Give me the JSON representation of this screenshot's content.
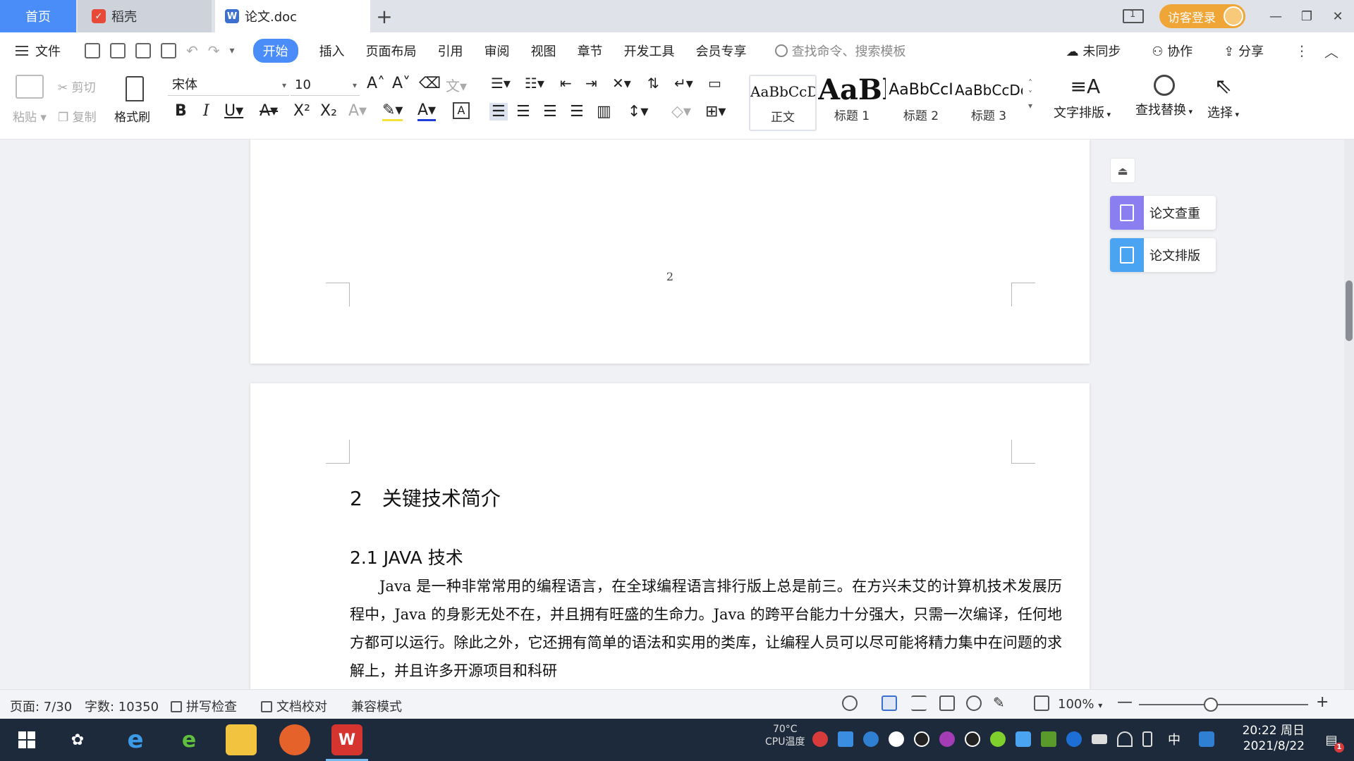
{
  "titlebar": {
    "tabs": [
      {
        "label": "首页"
      },
      {
        "label": "稻壳"
      },
      {
        "label": "论文.doc"
      }
    ],
    "login_label": "访客登录"
  },
  "menubar": {
    "file_label": "文件",
    "tabs": [
      "开始",
      "插入",
      "页面布局",
      "引用",
      "审阅",
      "视图",
      "章节",
      "开发工具",
      "会员专享"
    ],
    "search_placeholder": "查找命令、搜索模板",
    "sync_label": "未同步",
    "collab_label": "协作",
    "share_label": "分享"
  },
  "ribbon": {
    "paste_label": "粘贴",
    "cut_label": "剪切",
    "copy_label": "复制",
    "format_painter_label": "格式刷",
    "font_name": "宋体",
    "font_size": "10",
    "styles": [
      {
        "preview": "AaBbCcDd",
        "name": "正文"
      },
      {
        "preview": "AaBl",
        "name": "标题 1"
      },
      {
        "preview": "AaBbCcI",
        "name": "标题 2"
      },
      {
        "preview": "AaBbCcDd",
        "name": "标题 3"
      }
    ],
    "text_layout_label": "文字排版",
    "find_replace_label": "查找替换",
    "select_label": "选择"
  },
  "document": {
    "page_number": "2",
    "heading1": "2　关键技术简介",
    "heading2": "2.1  JAVA 技术",
    "paragraph": "Java 是一种非常常用的编程语言，在全球编程语言排行版上总是前三。在方兴未艾的计算机技术发展历程中，Java 的身影无处不在，并且拥有旺盛的生命力。Java 的跨平台能力十分强大，只需一次编译，任何地方都可以运行。除此之外，它还拥有简单的语法和实用的类库，让编程人员可以尽可能将精力集中在问题的求解上，并且许多开源项目和科研"
  },
  "side_panel": {
    "check_label": "论文查重",
    "format_label": "论文排版"
  },
  "statusbar": {
    "page": "页面: 7/30",
    "word_count": "字数: 10350",
    "spell_check": "拼写检查",
    "doc_proof": "文档校对",
    "compat_mode": "兼容模式",
    "zoom": "100%"
  },
  "taskbar": {
    "cpu_temp": "70°C",
    "cpu_label": "CPU温度",
    "ime": "中",
    "time": "20:22 周日",
    "date": "2021/8/22",
    "notification_count": "1"
  },
  "colors": {
    "accent": "#4a8df8",
    "login": "#f0a637",
    "taskbar": "#1d2a3c"
  }
}
